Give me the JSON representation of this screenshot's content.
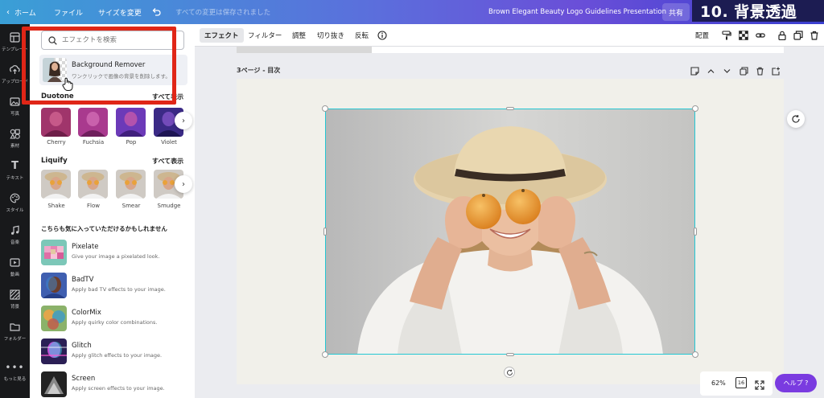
{
  "topbar": {
    "home": "ホーム",
    "file": "ファイル",
    "resize": "サイズを変更",
    "saved_status": "すべての変更は保存されました",
    "doc_title": "Brown Elegant Beauty Logo Guidelines Presentation",
    "share": "共有",
    "overlay_title": "10. 背景透過"
  },
  "rail": {
    "items": [
      {
        "label": "テンプレート",
        "icon": "template-icon"
      },
      {
        "label": "アップロード",
        "icon": "upload-icon"
      },
      {
        "label": "写真",
        "icon": "photo-icon"
      },
      {
        "label": "素材",
        "icon": "elements-icon"
      },
      {
        "label": "テキスト",
        "icon": "text-icon"
      },
      {
        "label": "スタイル",
        "icon": "palette-icon"
      },
      {
        "label": "音楽",
        "icon": "music-icon"
      },
      {
        "label": "動画",
        "icon": "video-icon"
      },
      {
        "label": "背景",
        "icon": "background-icon"
      },
      {
        "label": "フォルダー",
        "icon": "folder-icon"
      },
      {
        "label": "もっと見る",
        "icon": "more-icon"
      }
    ]
  },
  "panel": {
    "search_placeholder": "エフェクトを検索",
    "bg_remover": {
      "title": "Background Remover",
      "desc": "ワンクリックで画像の背景を削除します。"
    },
    "duotone": {
      "heading": "Duotone",
      "see_all": "すべて表示",
      "tiles": [
        {
          "label": "Cherry",
          "color": "#a0356b"
        },
        {
          "label": "Fuchsia",
          "color": "#a93a8e"
        },
        {
          "label": "Pop",
          "color": "#6c3ab8"
        },
        {
          "label": "Violet",
          "color": "#3b2a86"
        }
      ]
    },
    "liquify": {
      "heading": "Liquify",
      "see_all": "すべて表示",
      "tiles": [
        {
          "label": "Shake"
        },
        {
          "label": "Flow"
        },
        {
          "label": "Smear"
        },
        {
          "label": "Smudge"
        }
      ]
    },
    "recommend_heading": "こちらも気に入っていただけるかもしれません",
    "list": [
      {
        "title": "Pixelate",
        "desc": "Give your image a pixelated look."
      },
      {
        "title": "BadTV",
        "desc": "Apply bad TV effects to your image."
      },
      {
        "title": "ColorMix",
        "desc": "Apply quirky color combinations."
      },
      {
        "title": "Glitch",
        "desc": "Apply glitch effects to your image."
      },
      {
        "title": "Screen",
        "desc": "Apply screen effects to your image."
      }
    ]
  },
  "toolbar": {
    "effects": "エフェクト",
    "filter": "フィルター",
    "adjust": "調整",
    "crop": "切り抜き",
    "flip": "反転",
    "arrange": "配置"
  },
  "page": {
    "label": "3ページ - 目次"
  },
  "bottom": {
    "zoom": "62%",
    "page_count": "16",
    "help": "ヘルプ ?"
  },
  "colors": {
    "accent_highlight": "#e02617",
    "selection": "#24c7d3",
    "help_button": "#7a3be0"
  }
}
